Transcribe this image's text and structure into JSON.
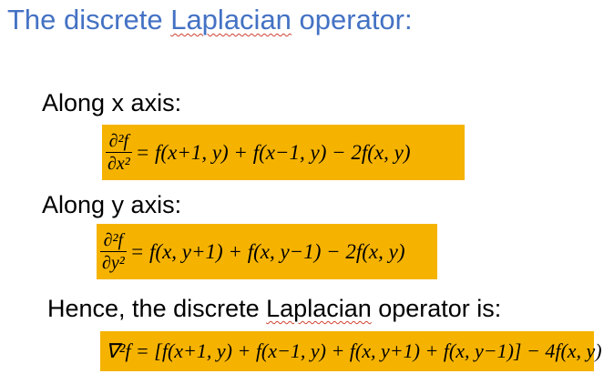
{
  "title": {
    "before": "The discrete ",
    "emph": "Laplacian",
    "after": " operator:"
  },
  "along_x": {
    "label": "Along x axis:",
    "lhs_num": "∂²f",
    "lhs_den": "∂x²",
    "rhs": "= f(x+1, y) + f(x−1, y) − 2f(x, y)"
  },
  "along_y": {
    "label": "Along y axis:",
    "lhs_num": "∂²f",
    "lhs_den": "∂y²",
    "rhs": "= f(x, y+1) + f(x, y−1) − 2f(x, y)"
  },
  "hence": {
    "before": "Hence, the discrete ",
    "emph": "Laplacian",
    "after": " operator is:"
  },
  "laplacian_formula": "∇²f = [f(x+1, y) + f(x−1, y) + f(x, y+1) + f(x, y−1)] − 4f(x, y)",
  "colors": {
    "title": "#4472C4",
    "equation_highlight": "#F5B300",
    "spellcheck_underline": "#D04030"
  }
}
